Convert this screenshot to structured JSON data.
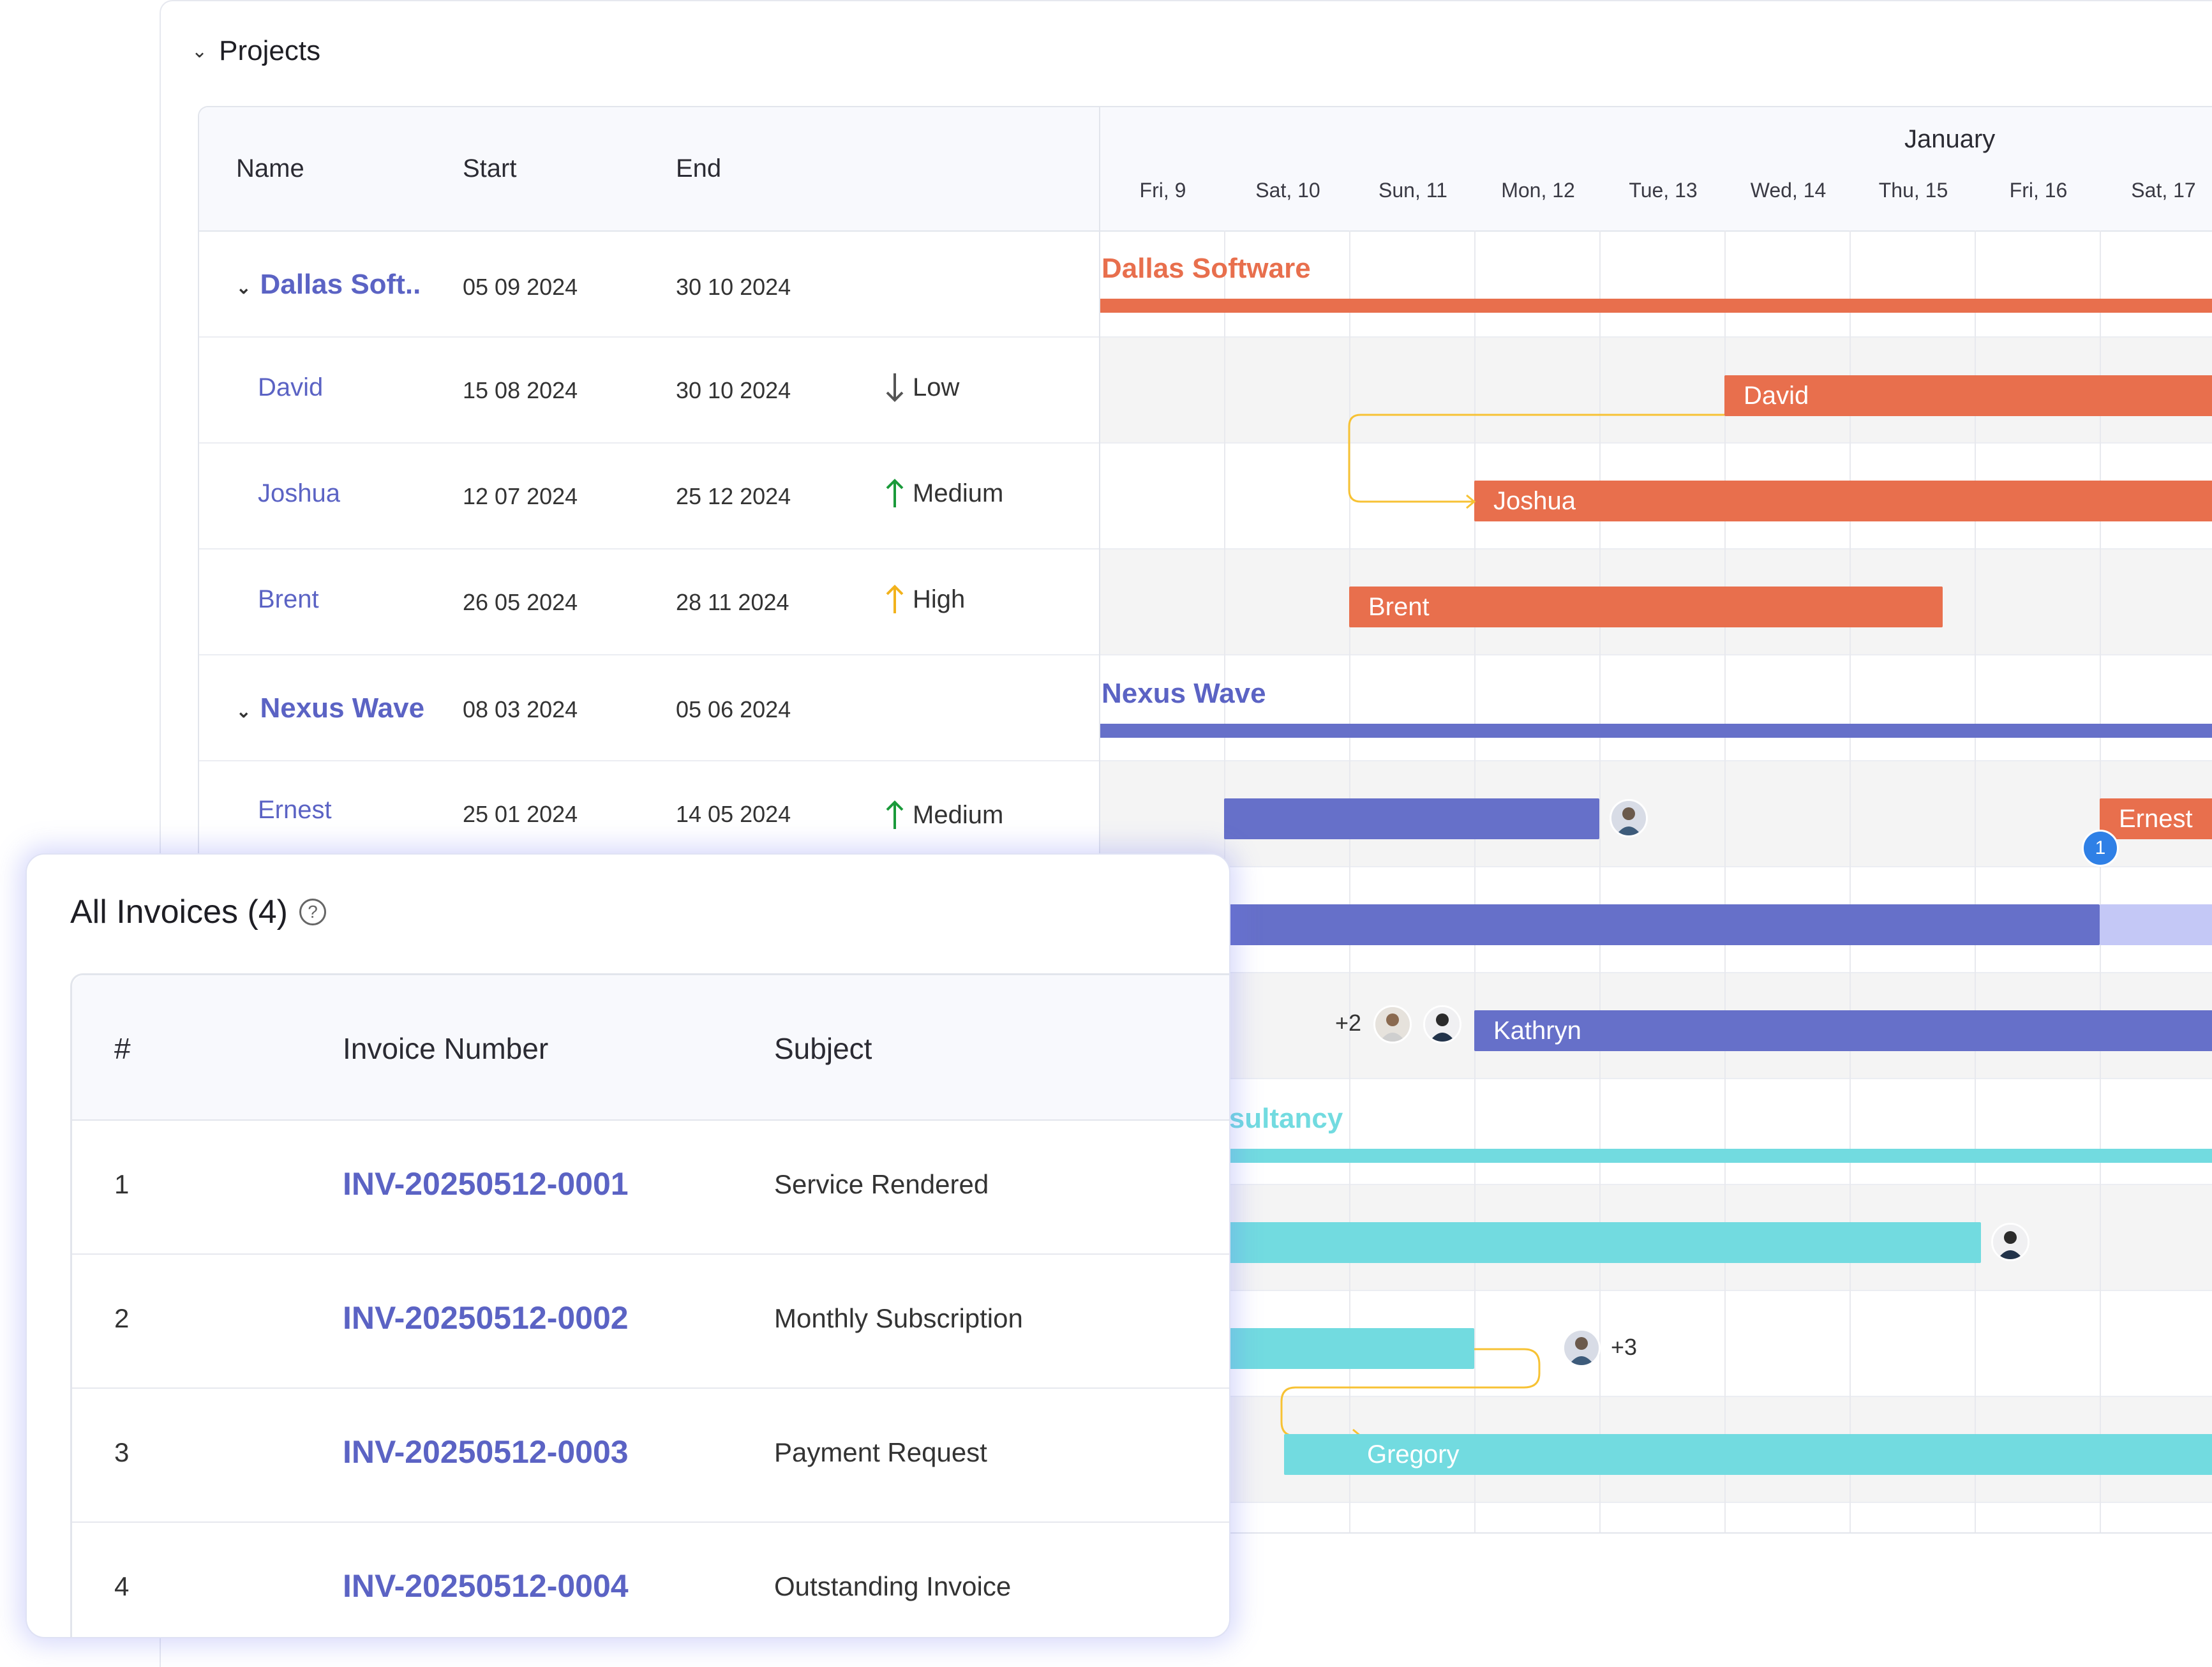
{
  "projects": {
    "title": "Projects",
    "columns": {
      "name": "Name",
      "start": "Start",
      "end": "End"
    },
    "month": "January",
    "days": [
      "Fri, 9",
      "Sat, 10",
      "Sun, 11",
      "Mon, 12",
      "Tue, 13",
      "Wed, 14",
      "Thu, 15",
      "Fri, 16",
      "Sat, 17"
    ],
    "rows": [
      {
        "name": "Dallas Soft..",
        "start": "05 09 2024",
        "end": "30 10 2024"
      },
      {
        "name": "David",
        "start": "15 08 2024",
        "end": "30 10 2024",
        "priority": "Low"
      },
      {
        "name": "Joshua",
        "start": "12 07 2024",
        "end": "25 12 2024",
        "priority": "Medium"
      },
      {
        "name": "Brent",
        "start": "26 05 2024",
        "end": "28 11 2024",
        "priority": "High"
      },
      {
        "name": "Nexus Wave",
        "start": "08 03 2024",
        "end": "05 06 2024"
      },
      {
        "name": "Ernest",
        "start": "25 01 2024",
        "end": "14 05 2024",
        "priority": "Medium"
      }
    ],
    "timeline": {
      "dallas_label": "Dallas Software",
      "david_bar": "David",
      "joshua_bar": "Joshua",
      "brent_bar": "Brent",
      "nexus_label": "Nexus Wave",
      "ernest_bar": "Ernest",
      "ernest_badge": "1",
      "kathryn_bar": "Kathryn",
      "kathryn_more": "+2",
      "consultancy_label": "onsultancy",
      "row11_more": "+3",
      "gregory_bar": "Gregory"
    },
    "colors": {
      "orange": "#e86f4d",
      "purple": "#6670c9",
      "cyan": "#72dbe0",
      "link": "#5b63c4",
      "dependency": "#f7c234"
    }
  },
  "invoices": {
    "title": "All Invoices (4)",
    "help_icon": "question-circle-icon",
    "columns": {
      "index": "#",
      "number": "Invoice Number",
      "subject": "Subject"
    },
    "rows": [
      {
        "index": "1",
        "number": "INV-20250512-0001",
        "subject": "Service Rendered"
      },
      {
        "index": "2",
        "number": "INV-20250512-0002",
        "subject": "Monthly Subscription"
      },
      {
        "index": "3",
        "number": "INV-20250512-0003",
        "subject": "Payment Request"
      },
      {
        "index": "4",
        "number": "INV-20250512-0004",
        "subject": "Outstanding Invoice"
      }
    ]
  }
}
